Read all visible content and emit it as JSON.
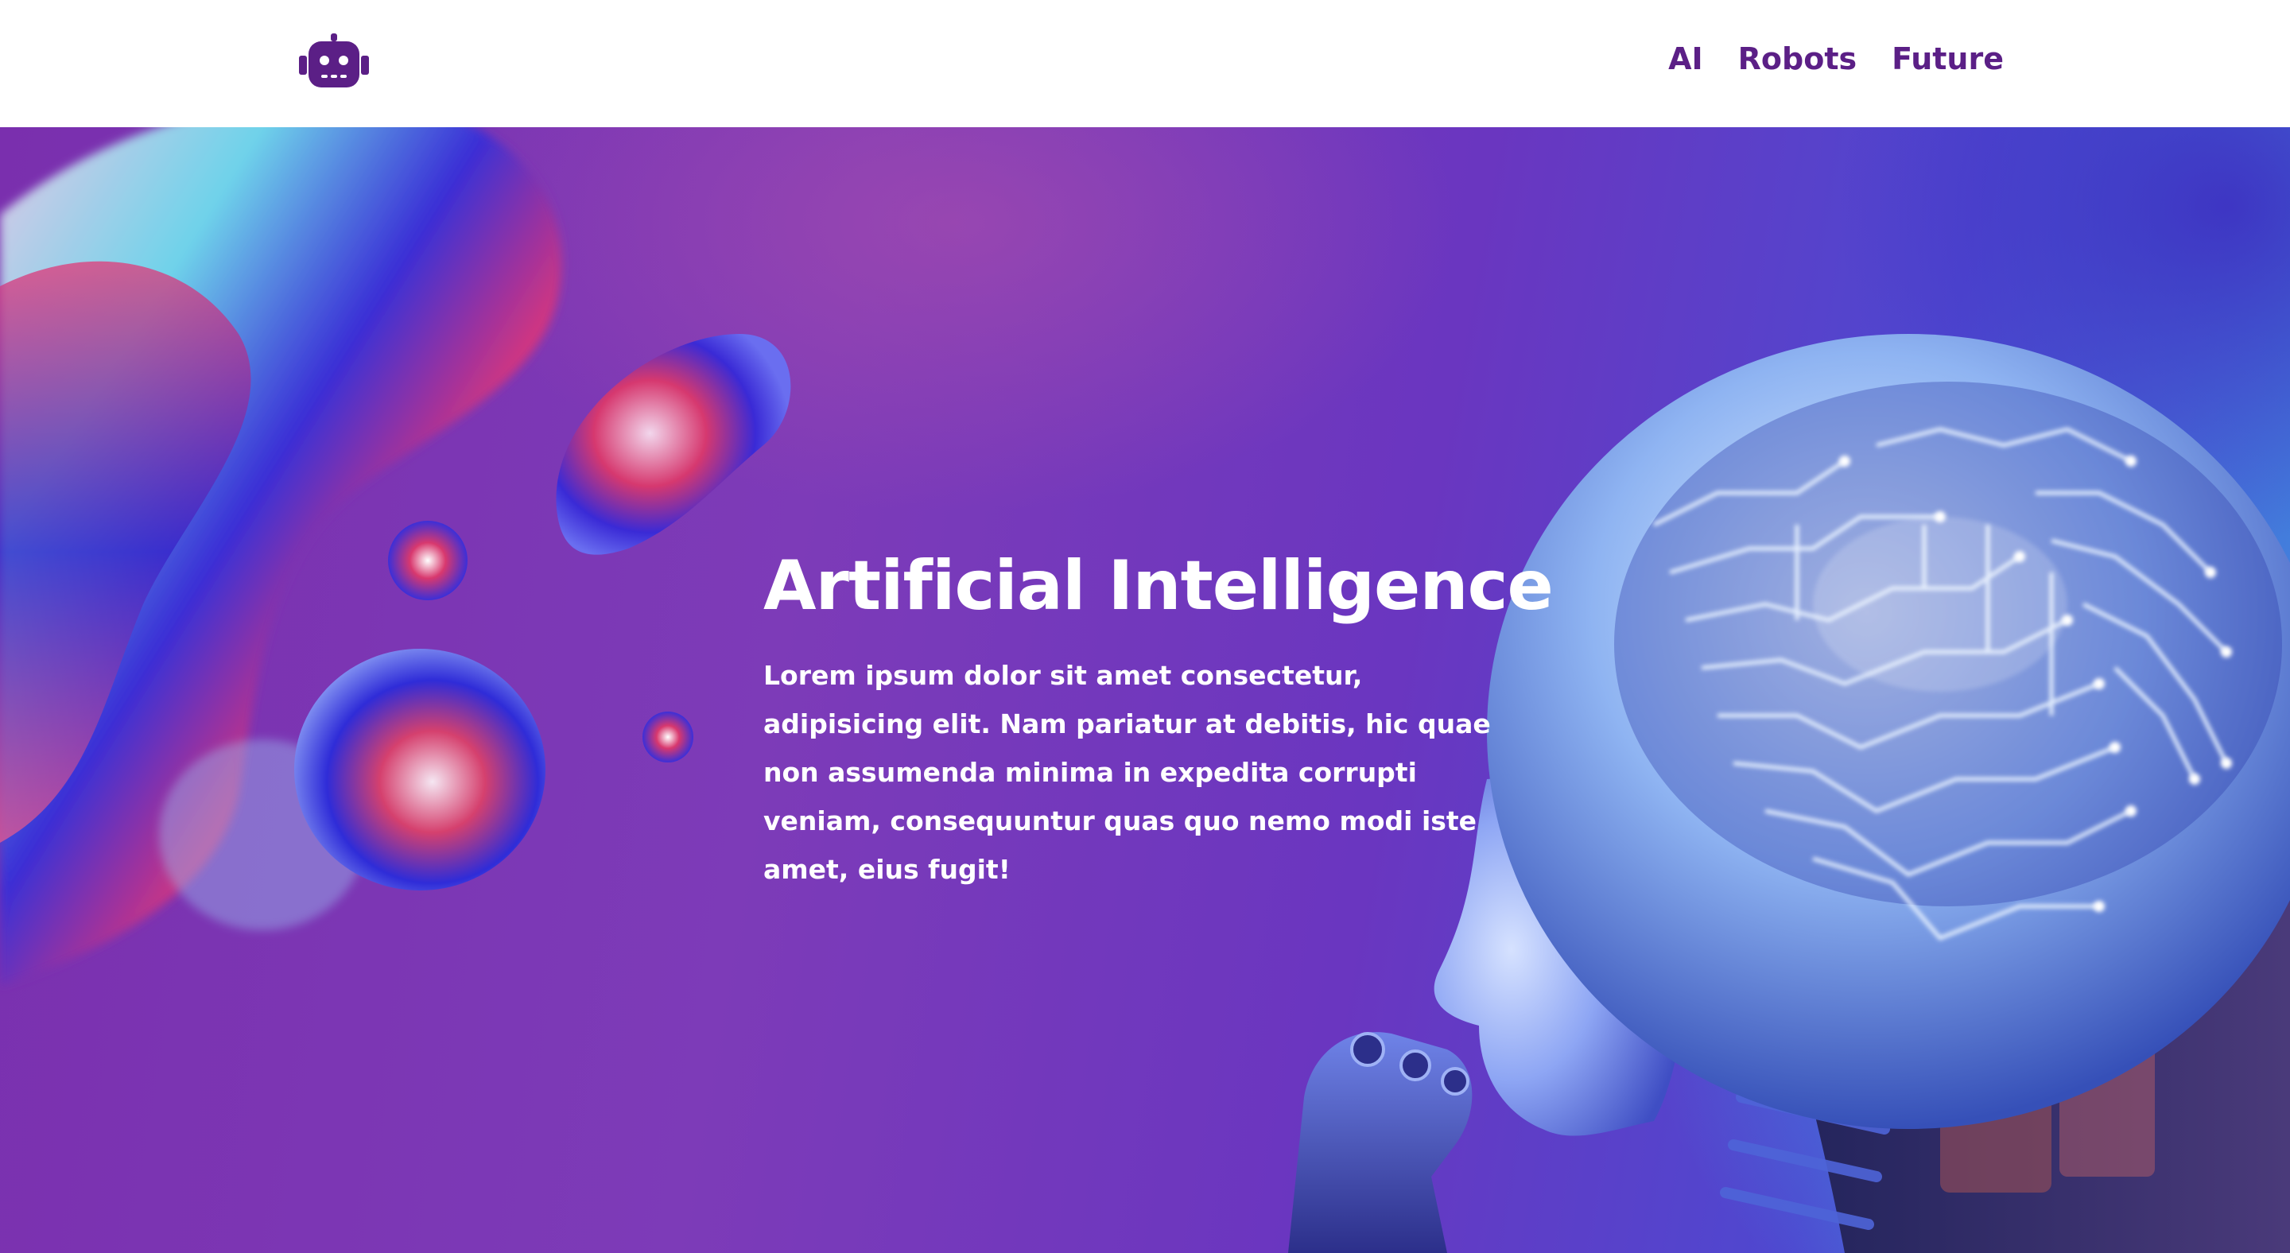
{
  "header": {
    "logo_icon": "robot-head-icon",
    "nav": [
      {
        "label": "AI"
      },
      {
        "label": "Robots"
      },
      {
        "label": "Future"
      }
    ]
  },
  "hero": {
    "title": "Artificial Intelligence",
    "description": "Lorem ipsum dolor sit amet consectetur, adipisicing elit. Nam pariatur at debitis, hic quae non assumenda minima in expedita corrupti veniam, consequuntur quas quo nemo modi iste amet, eius fugit!",
    "decor_icon": "liquid-blobs-illustration",
    "image_icon": "robot-with-circuit-brain-image"
  },
  "colors": {
    "brand": "#5b1f86",
    "hero_purple": "#7a2fae",
    "hero_blue": "#3f8fe0",
    "text_on_hero": "#ffffff"
  }
}
